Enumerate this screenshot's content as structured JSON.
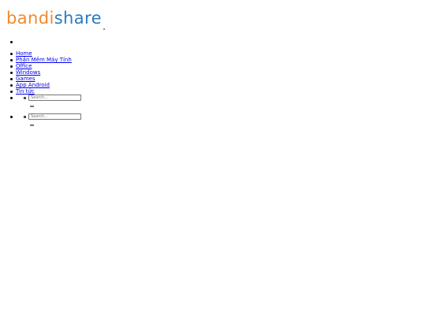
{
  "brand": {
    "logo_part_a": "bandi",
    "logo_part_b": "share",
    "logo_color_a": "#f28a2e",
    "logo_color_b": "#2a7bbf"
  },
  "nav": {
    "items": [
      {
        "label": "Home"
      },
      {
        "label": "Phần Mềm Máy Tính"
      },
      {
        "label": "Office"
      },
      {
        "label": "Windows"
      },
      {
        "label": "Games"
      },
      {
        "label": "App Android"
      },
      {
        "label": "Tin tức"
      }
    ],
    "link_color": "#0000ee"
  },
  "search": {
    "primary": {
      "placeholder": "Search..."
    },
    "secondary": {
      "placeholder": "Search..."
    }
  }
}
